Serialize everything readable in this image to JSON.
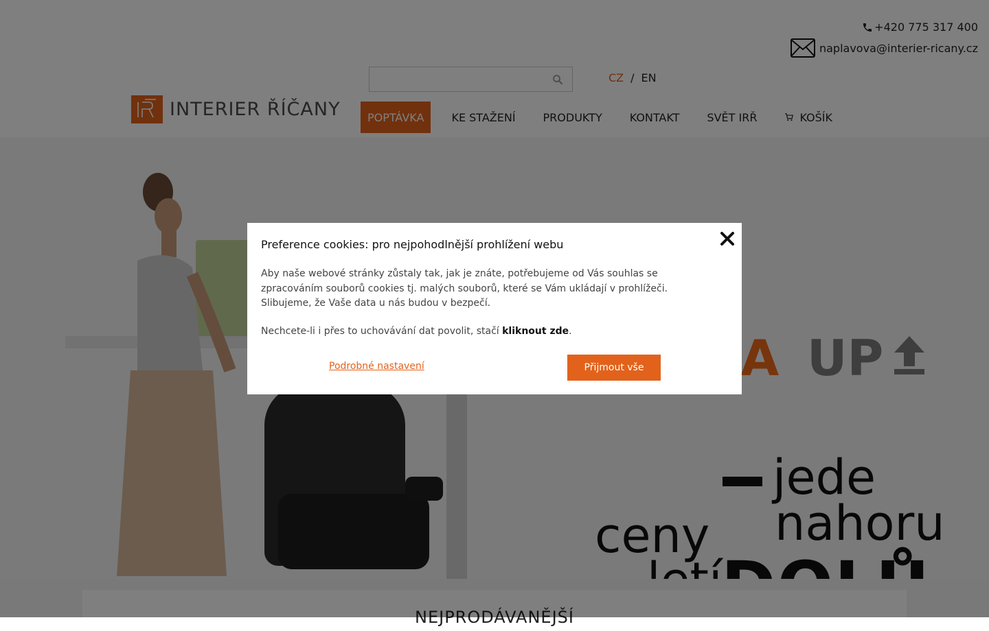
{
  "header": {
    "phone": "+420 775 317 400",
    "email": "naplavova@interier-ricany.cz",
    "search": {
      "placeholder": ""
    },
    "lang": {
      "cz": "CZ",
      "sep": "/",
      "en": "EN"
    },
    "logo_text": "INTERIER ŘÍČANY",
    "nav": [
      {
        "label": "POPTÁVKA"
      },
      {
        "label": "KE STAŽENÍ"
      },
      {
        "label": "PRODUKTY"
      },
      {
        "label": "KONTAKT"
      },
      {
        "label": "SVĚT IRŘ"
      },
      {
        "label": "KOŠÍK"
      }
    ],
    "colors": {
      "accent": "#e2621b",
      "text": "#222222"
    }
  },
  "hero": {
    "alfa": "ALFA",
    "up": "UP",
    "line1": "jede",
    "line2": "nahoru",
    "ceny": "ceny",
    "leti": "letí",
    "dolu": "DOLŮ"
  },
  "section": {
    "title": "NEJPRODÁVANĚJŠÍ"
  },
  "cookie_modal": {
    "title": "Preference cookies: pro nejpohodlnější prohlížení webu",
    "text": "Aby naše webové stránky zůstaly tak, jak je znáte, potřebujeme od Vás souhlas se zpracováním souborů cookies tj. malých souborů, které se Vám ukládají v prohlížeči. Slibujeme, že Vaše data u nás budou v bezpečí.",
    "text2_prefix": "Nechcete-li i přes to uchovávání dat povolit, stačí ",
    "text2_link": "kliknout zde",
    "text2_suffix": ".",
    "settings_link": "Podrobné nastavení",
    "accept_button": "Přijmout vše"
  }
}
